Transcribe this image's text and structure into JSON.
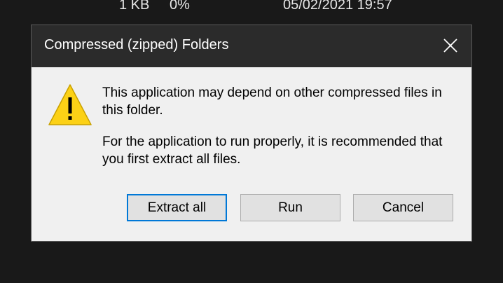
{
  "background": {
    "file_size": "1 KB",
    "ratio": "0%",
    "date": "05/02/2021 19:57"
  },
  "dialog": {
    "title": "Compressed (zipped) Folders",
    "icon": "warning-icon",
    "message_line1": "This application may depend on other compressed files in this folder.",
    "message_line2": "For the application to run properly, it is recommended that you first extract all files.",
    "buttons": {
      "extract_all": "Extract all",
      "run": "Run",
      "cancel": "Cancel"
    }
  },
  "colors": {
    "titlebar": "#2b2b2b",
    "dialog_bg": "#f0f0f0",
    "default_button_border": "#0078d7",
    "warning_yellow": "#fcd116"
  }
}
